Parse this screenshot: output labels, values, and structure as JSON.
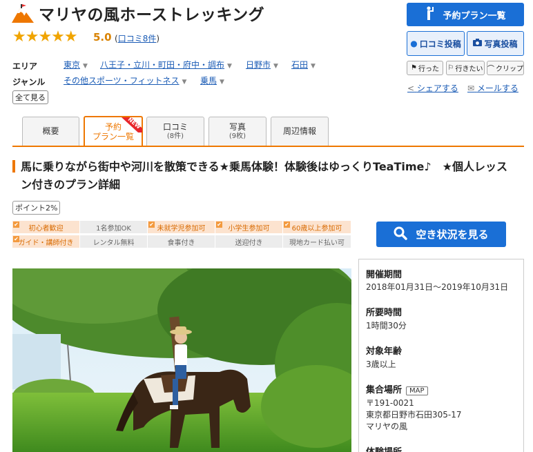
{
  "header": {
    "title": "マリヤの風ホーストレッキング",
    "stars": "★★★★★",
    "rating": "5.0",
    "reviews_open": "(",
    "reviews_link": "口コミ8件",
    "reviews_close": ")"
  },
  "meta": {
    "area_label": "エリア",
    "area_items": [
      "東京",
      "八王子・立川・町田・府中・調布",
      "日野市",
      "石田"
    ],
    "genre_label": "ジャンル",
    "genre_items": [
      "その他スポーツ・フィットネス",
      "乗馬"
    ],
    "see_all": "全て見る"
  },
  "actions": {
    "plan_list": "予約プラン一覧",
    "post_review": "口コミ投稿",
    "post_photo": "写真投稿",
    "went": "行った",
    "want": "行きたい",
    "clip": "クリップ",
    "share": "シェアする",
    "mail": "メールする"
  },
  "tabs": [
    {
      "label": "概要",
      "sub": ""
    },
    {
      "label": "予約",
      "sub": "プラン一覧"
    },
    {
      "label": "口コミ",
      "sub": "(8件)"
    },
    {
      "label": "写真",
      "sub": "(9枚)"
    },
    {
      "label": "周辺情報",
      "sub": ""
    }
  ],
  "new_badge": "NEW",
  "plan": {
    "title": "馬に乗りながら街中や河川を散策できる★乗馬体験！体験後はゆっくりTeaTime♪　★個人レッスン付きのプラン詳細",
    "point": "ポイント2%",
    "tags_row1": [
      "初心者歓迎",
      "1名参加OK",
      "未就学児参加可",
      "小学生参加可",
      "60歳以上参加可"
    ],
    "tags_row2": [
      "ガイド・講師付き",
      "レンタル無料",
      "食事付き",
      "送迎付き",
      "現地カード払い可"
    ],
    "availability_button": "空き状況を見る"
  },
  "info": {
    "period_label": "開催期間",
    "period_value": "2018年01月31日～2019年10月31日",
    "duration_label": "所要時間",
    "duration_value": "1時間30分",
    "age_label": "対象年齢",
    "age_value": "3歳以上",
    "meeting_label": "集合場所",
    "map_button": "MAP",
    "postal": "〒191-0021",
    "address": "東京都日野市石田305-17",
    "place": "マリヤの風",
    "venue_label": "体験場所"
  },
  "colors": {
    "accent": "#ee7700",
    "primary_button": "#1a6fd6",
    "star": "#f0a400",
    "link": "#1a5bb5"
  }
}
